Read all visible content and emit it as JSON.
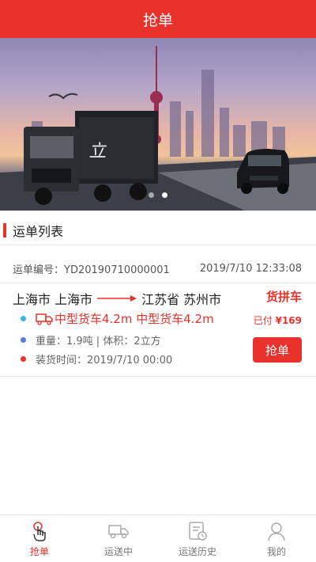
{
  "header": {
    "title": "抢单"
  },
  "banner": {
    "slide_count": 2,
    "active_slide": 2
  },
  "section": {
    "title": "运单列表"
  },
  "order": {
    "number_label": "运单编号：",
    "number": "YD20190710000001",
    "datetime": "2019/7/10 12:33:08",
    "origin": "上海市 上海市",
    "destination": "江苏省 苏州市",
    "type_tag": "货拼车",
    "truck_types": "中型货车4.2m 中型货车4.2m",
    "paid_label": "已付",
    "price": "¥169",
    "weight_volume": "重量：1.9吨 | 体积：2立方",
    "load_time": "装货时间：2019/7/10 00:00",
    "grab_label": "抢单",
    "bullet_colors": [
      "#34b6e8",
      "#5b7be0",
      "#e8322b"
    ]
  },
  "tabbar": {
    "items": [
      {
        "label": "抢单",
        "icon": "hand-tap-icon",
        "active": true
      },
      {
        "label": "运送中",
        "icon": "truck-icon",
        "active": false
      },
      {
        "label": "运送历史",
        "icon": "history-list-icon",
        "active": false
      },
      {
        "label": "我的",
        "icon": "user-icon",
        "active": false
      }
    ]
  },
  "colors": {
    "accent": "#e8322b",
    "text": "#333333",
    "muted": "#777777"
  }
}
